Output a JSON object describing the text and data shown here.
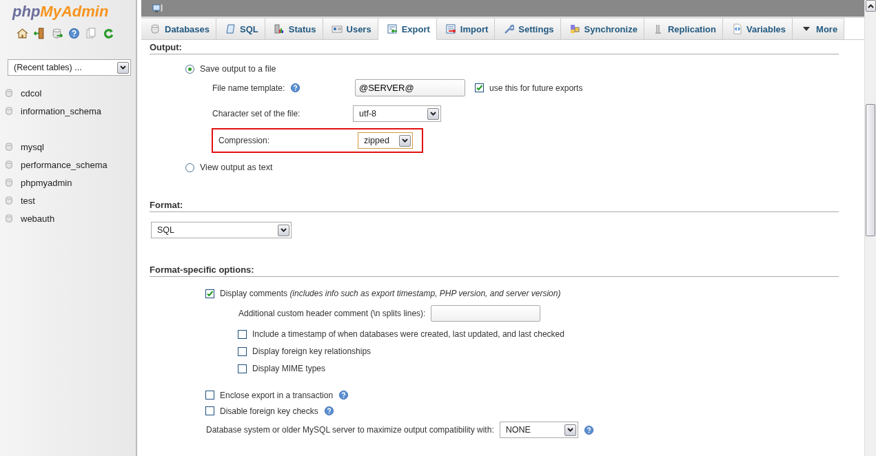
{
  "sidebar": {
    "logo": [
      "php",
      "MyAdmin"
    ],
    "recent_tables": {
      "value": "(Recent tables) ..."
    },
    "database_groups": [
      [
        "cdcol",
        "information_schema"
      ],
      [
        "mysql",
        "performance_schema",
        "phpmyadmin",
        "test",
        "webauth"
      ]
    ]
  },
  "tabs": [
    {
      "label": "Databases",
      "selected": false
    },
    {
      "label": "SQL",
      "selected": false
    },
    {
      "label": "Status",
      "selected": false
    },
    {
      "label": "Users",
      "selected": false
    },
    {
      "label": "Export",
      "selected": true
    },
    {
      "label": "Import",
      "selected": false
    },
    {
      "label": "Settings",
      "selected": false
    },
    {
      "label": "Synchronize",
      "selected": false
    },
    {
      "label": "Replication",
      "selected": false
    },
    {
      "label": "Variables",
      "selected": false
    },
    {
      "label": "More",
      "selected": false
    }
  ],
  "output": {
    "title": "Output:",
    "save_to_file": {
      "label": "Save output to a file",
      "selected": true
    },
    "file_name_template": {
      "label": "File name template:",
      "value": "@SERVER@",
      "remember": {
        "label": "use this for future exports",
        "checked": true
      }
    },
    "charset": {
      "label": "Character set of the file:",
      "value": "utf-8"
    },
    "compression": {
      "label": "Compression:",
      "value": "zipped",
      "highlighted": true
    },
    "view_as_text": {
      "label": "View output as text",
      "selected": false
    }
  },
  "format": {
    "title": "Format:",
    "value": "SQL"
  },
  "format_options": {
    "title": "Format-specific options:",
    "display_comments": {
      "label": "Display comments",
      "note": "(includes info such as export timestamp, PHP version, and server version)",
      "checked": true
    },
    "header_comment": {
      "label": "Additional custom header comment (\\n splits lines):"
    },
    "sub_options": [
      {
        "label": "Include a timestamp of when databases were created, last updated, and last checked",
        "checked": false
      },
      {
        "label": "Display foreign key relationships",
        "checked": false
      },
      {
        "label": "Display MIME types",
        "checked": false
      }
    ],
    "options": [
      {
        "label": "Enclose export in a transaction",
        "checked": false
      },
      {
        "label": "Disable foreign key checks",
        "checked": false
      }
    ],
    "compatibility": {
      "label": "Database system or older MySQL server to maximize output compatibility with:",
      "value": "NONE"
    }
  }
}
